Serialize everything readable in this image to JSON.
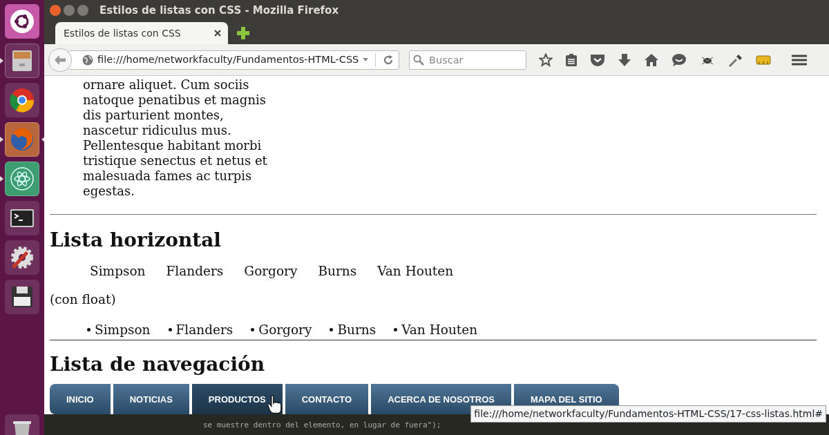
{
  "launcher": {
    "items": [
      {
        "kind": "ubuntu",
        "running": false,
        "focused": false
      },
      {
        "kind": "files",
        "running": true,
        "focused": false
      },
      {
        "kind": "chrome",
        "running": false,
        "focused": false
      },
      {
        "kind": "firefox",
        "running": true,
        "focused": true
      },
      {
        "kind": "atom",
        "running": true,
        "focused": false
      },
      {
        "kind": "terminal",
        "running": false,
        "focused": false
      },
      {
        "kind": "settings",
        "running": false,
        "focused": false
      },
      {
        "kind": "save",
        "running": false,
        "focused": false
      },
      {
        "kind": "trash",
        "running": false,
        "focused": false
      }
    ]
  },
  "window": {
    "title": "Estilos de listas con CSS - Mozilla Firefox"
  },
  "tabs": [
    {
      "label": "Estilos de listas con CSS",
      "selected": true
    }
  ],
  "toolbar": {
    "url": "file:///home/networkfaculty/Fundamentos-HTML-CSS",
    "search": {
      "placeholder": "Buscar"
    }
  },
  "content": {
    "paragraph_lines": [
      "ornare aliquet. Cum sociis",
      "natoque penatibus et magnis",
      "dis parturient montes,",
      "nascetur ridiculus mus.",
      "Pellentesque habitant morbi",
      "tristique senectus et netus et",
      "malesuada fames ac turpis",
      "egestas."
    ],
    "sections": [
      {
        "kind": "heading",
        "text": "Lista horizontal"
      },
      {
        "kind": "inline_list",
        "items": [
          "Simpson",
          "Flanders",
          "Gorgory",
          "Burns",
          "Van Houten"
        ]
      },
      {
        "kind": "note",
        "text": "(con float)"
      },
      {
        "kind": "bullet_list",
        "items": [
          "Simpson",
          "Flanders",
          "Gorgory",
          "Burns",
          "Van Houten"
        ]
      },
      {
        "kind": "rule"
      },
      {
        "kind": "heading",
        "text": "Lista de navegación"
      },
      {
        "kind": "nav",
        "items": [
          {
            "label": "INICIO",
            "selected": false
          },
          {
            "label": "NOTICIAS",
            "selected": false
          },
          {
            "label": "PRODUCTOS",
            "selected": true
          },
          {
            "label": "CONTACTO",
            "selected": false
          },
          {
            "label": "ACERCA DE NOSOTROS",
            "selected": false
          },
          {
            "label": "MAPA DEL SITIO",
            "selected": false
          }
        ]
      }
    ]
  },
  "editor_line": "se muestre dentro del elemento, en lugar de fuera\");",
  "status_tooltip": "file:///home/networkfaculty/Fundamentos-HTML-CSS/17-css-listas.html#"
}
